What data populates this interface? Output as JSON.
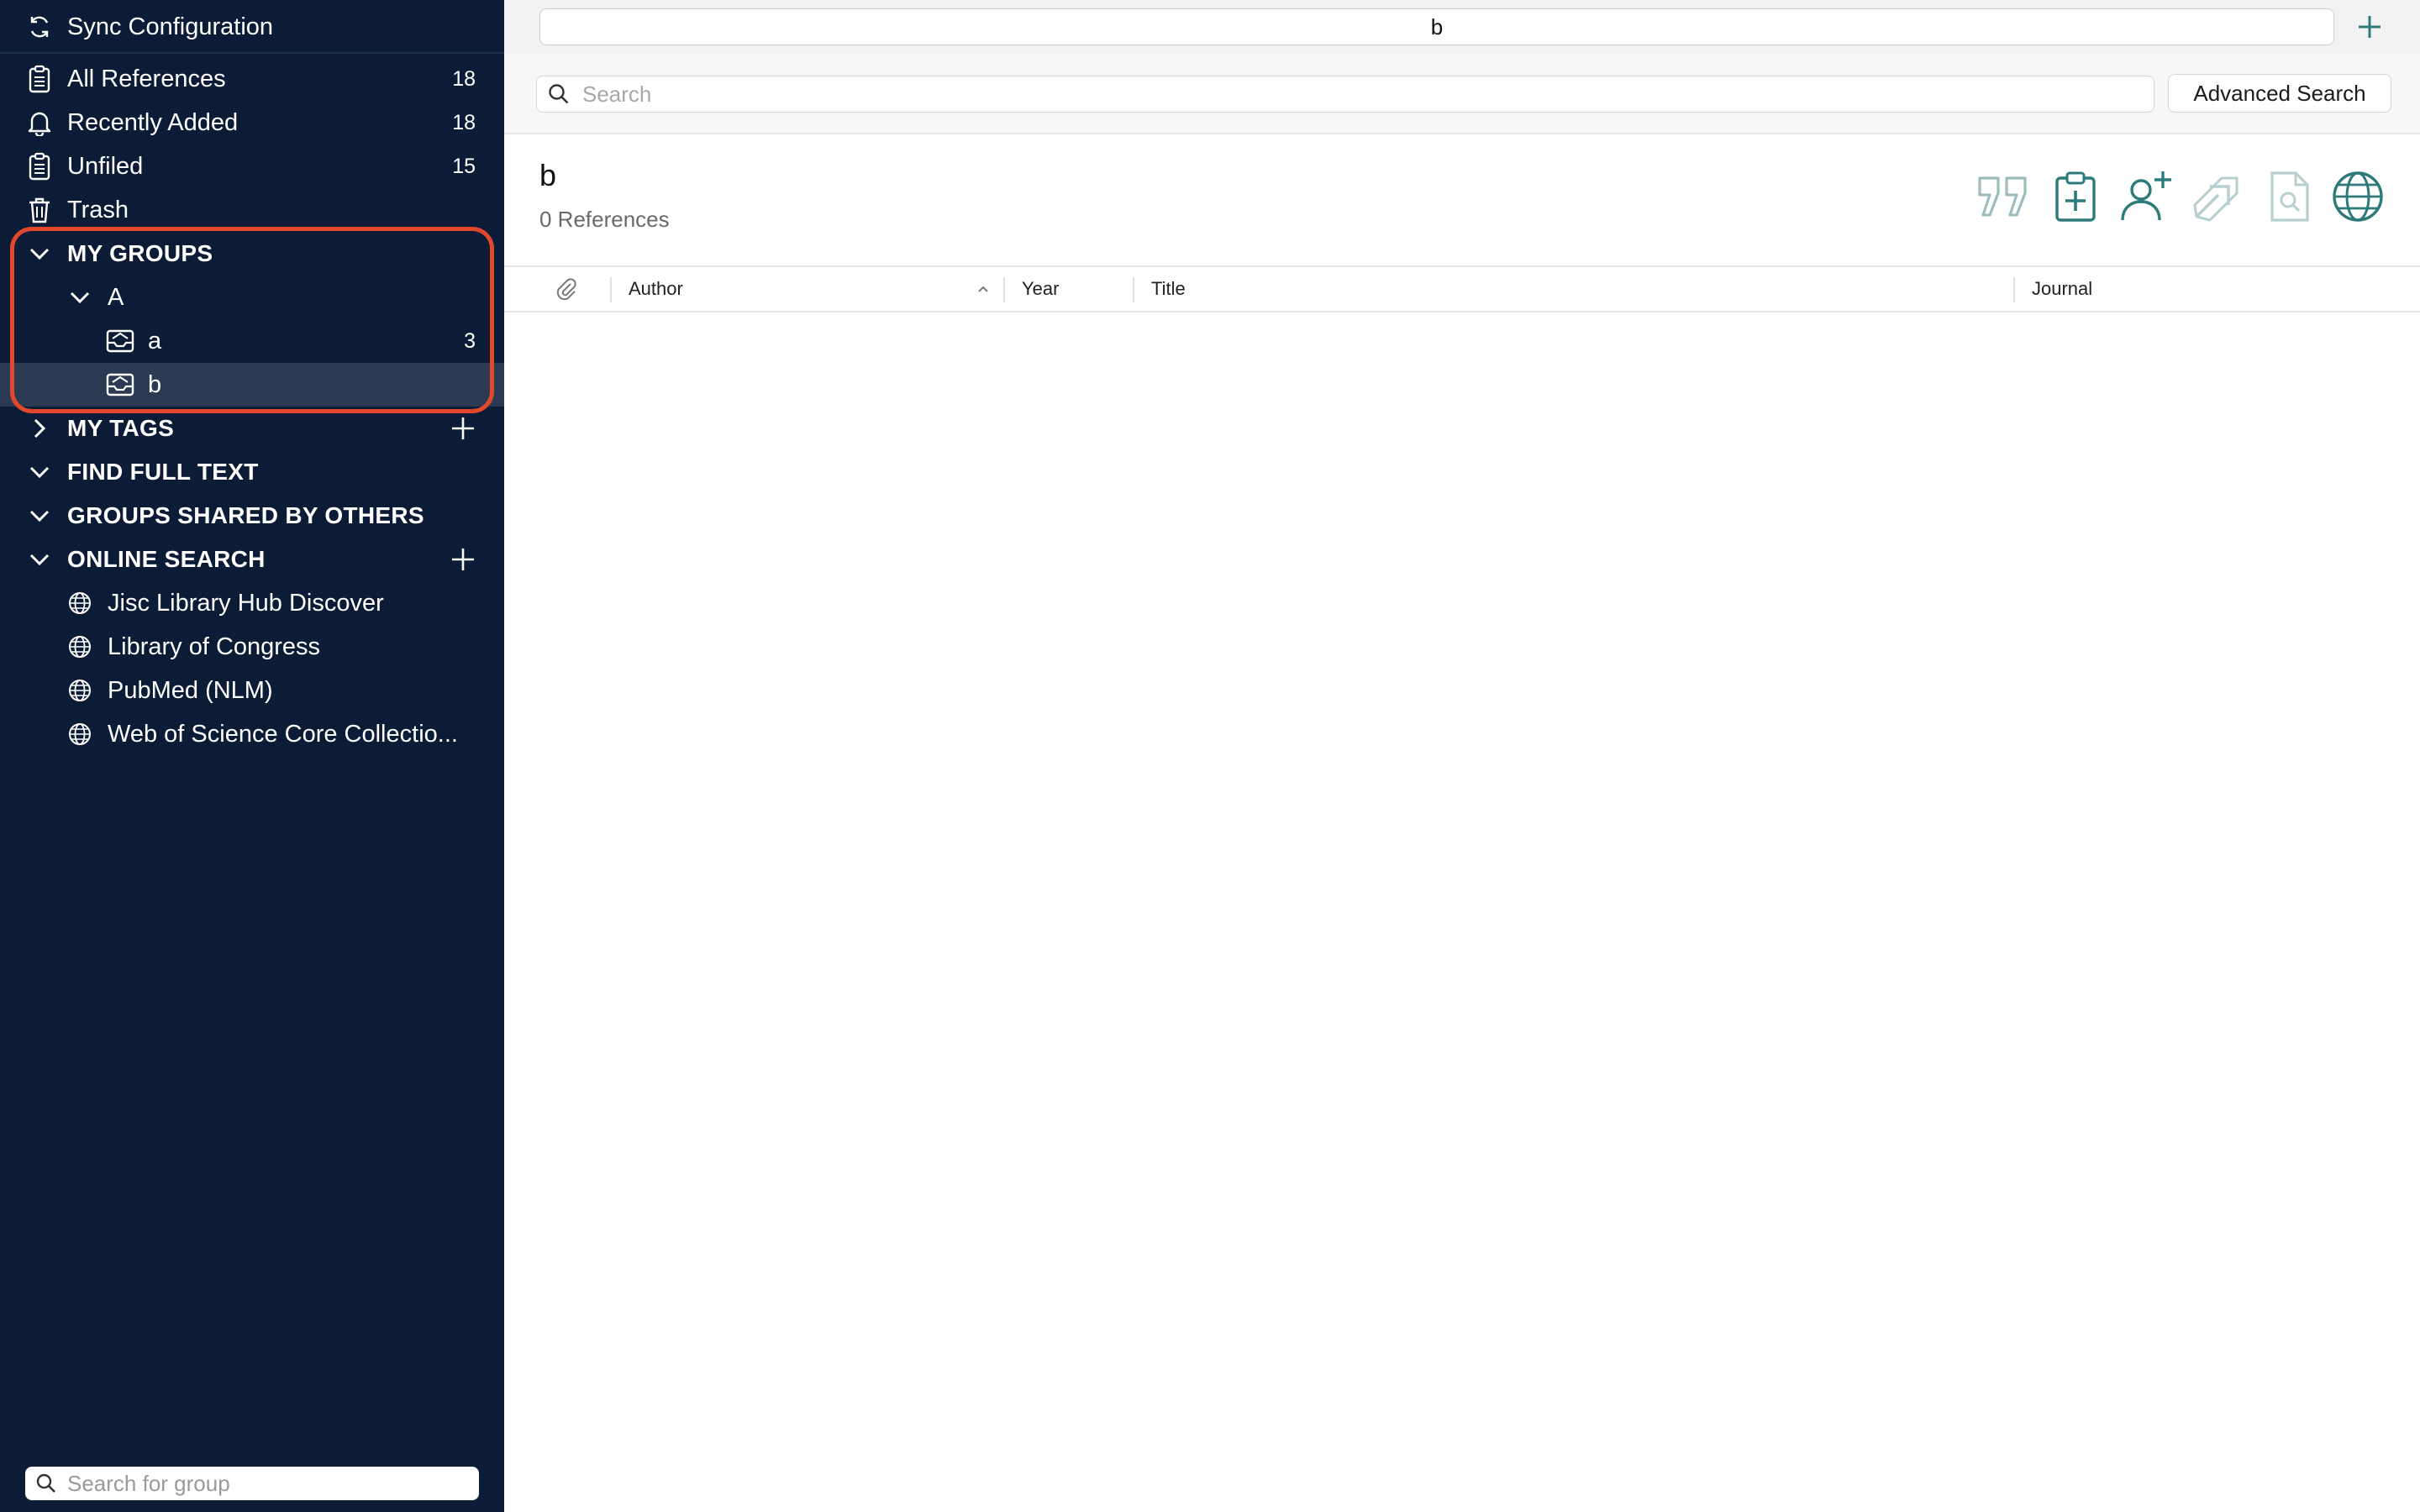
{
  "sidebar": {
    "sync": {
      "label": "Sync Configuration"
    },
    "library": [
      {
        "label": "All References",
        "count": "18",
        "icon": "clipboard-icon"
      },
      {
        "label": "Recently Added",
        "count": "18",
        "icon": "bell-icon"
      },
      {
        "label": "Unfiled",
        "count": "15",
        "icon": "clipboard-icon"
      },
      {
        "label": "Trash",
        "count": "",
        "icon": "trash-icon"
      }
    ],
    "my_groups": {
      "label": "MY GROUPS",
      "set": {
        "label": "A"
      },
      "groups": [
        {
          "label": "a",
          "count": "3"
        },
        {
          "label": "b",
          "count": ""
        }
      ]
    },
    "my_tags": {
      "label": "MY TAGS"
    },
    "find_full_text": {
      "label": "FIND FULL TEXT"
    },
    "groups_shared": {
      "label": "GROUPS SHARED BY OTHERS"
    },
    "online_search": {
      "label": "ONLINE SEARCH",
      "items": [
        {
          "label": "Jisc Library Hub Discover"
        },
        {
          "label": "Library of Congress"
        },
        {
          "label": "PubMed (NLM)"
        },
        {
          "label": "Web of Science Core Collectio..."
        }
      ]
    },
    "group_search": {
      "placeholder": "Search for group"
    }
  },
  "main": {
    "tab": {
      "label": "b"
    },
    "search": {
      "placeholder": "Search",
      "advanced_label": "Advanced Search"
    },
    "group_title": "b",
    "reference_count": "0 References",
    "toolbar": [
      "quote-icon",
      "add-reference-icon",
      "share-user-icon",
      "export-icon",
      "find-pdf-icon",
      "online-globe-icon"
    ],
    "columns": {
      "author": "Author",
      "year": "Year",
      "title": "Title",
      "journal": "Journal"
    }
  },
  "colors": {
    "sidebar_bg": "#0c1c36",
    "selected_row": "#2b3a52",
    "highlight": "#e2472c",
    "accent_teal": "#2d7a7a"
  }
}
